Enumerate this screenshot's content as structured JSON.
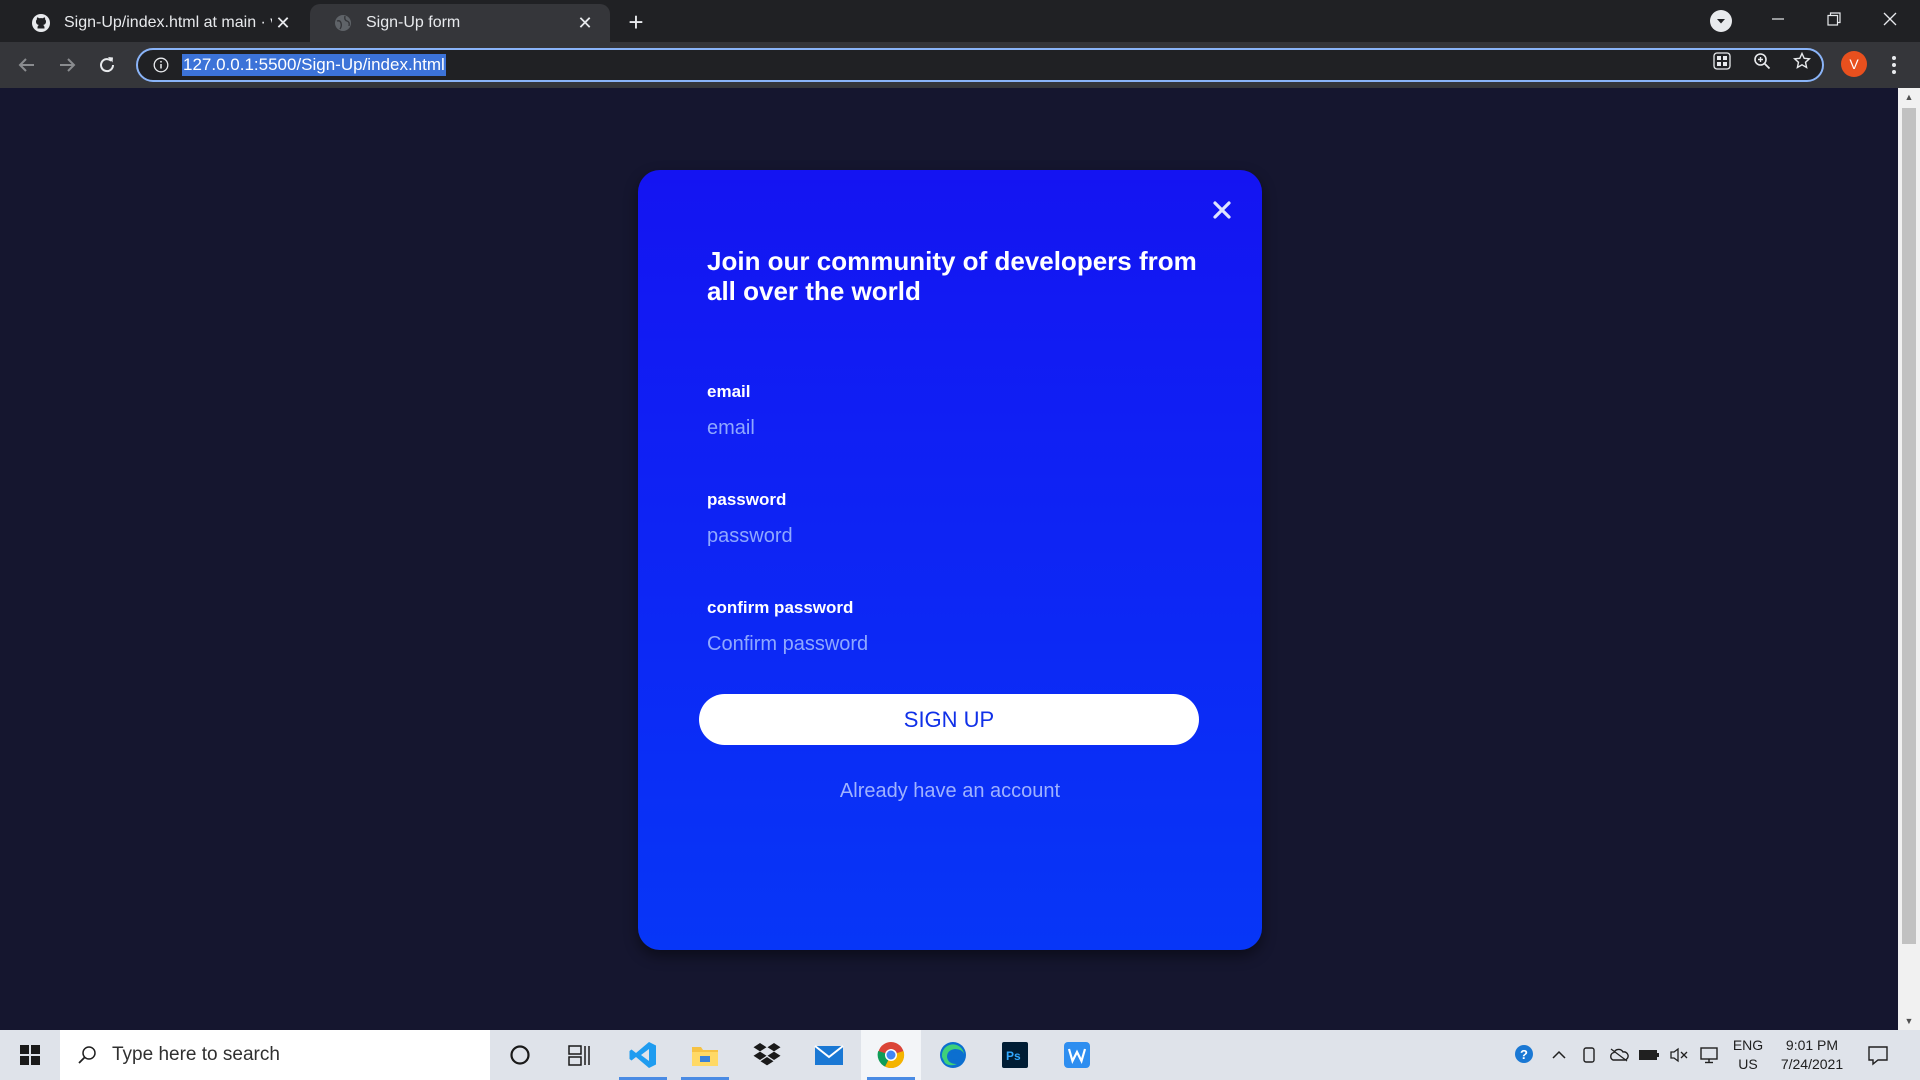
{
  "browser": {
    "tabs": [
      {
        "title": "Sign-Up/index.html at main · vai",
        "active": false,
        "favicon": "github-icon"
      },
      {
        "title": "Sign-Up form",
        "active": true,
        "favicon": "globe-icon"
      }
    ],
    "address": "127.0.0.1:5500/Sign-Up/index.html",
    "profile_initial": "V"
  },
  "signup": {
    "heading": "Join our community of developers from all over the world",
    "fields": [
      {
        "label": "email",
        "placeholder": "email"
      },
      {
        "label": "password",
        "placeholder": "password"
      },
      {
        "label": "confirm password",
        "placeholder": "Confirm password"
      }
    ],
    "button": "SIGN UP",
    "login_link": "Already have an account"
  },
  "taskbar": {
    "search_placeholder": "Type here to search",
    "apps": [
      "cortana-icon",
      "task-view-icon",
      "vscode-icon",
      "file-explorer-icon",
      "dropbox-icon",
      "mail-icon",
      "chrome-icon",
      "edge-icon",
      "photoshop-icon",
      "wps-icon"
    ],
    "language": [
      "ENG",
      "US"
    ],
    "time": "9:01 PM",
    "date": "7/24/2021"
  },
  "colors": {
    "page_bg": "#15162f",
    "card_top": "#1414f2",
    "card_bottom": "#0736f7",
    "button_text": "#1030e8"
  }
}
